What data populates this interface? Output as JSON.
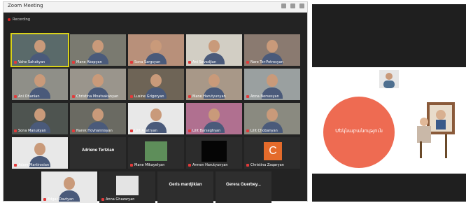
{
  "call": {
    "title": "Zoom Meeting",
    "recording_label": "Recording",
    "tiles": [
      {
        "name": "Vahe Sahakyan",
        "type": "video",
        "bg": "#5a6a6a",
        "active": true
      },
      {
        "name": "Mane Akopyan",
        "type": "video",
        "bg": "#7a7a70"
      },
      {
        "name": "Sona Sargsyan",
        "type": "video",
        "bg": "#b8907a"
      },
      {
        "name": "Ani Sevadjian",
        "type": "video",
        "bg": "#d2cec4"
      },
      {
        "name": "Nare Ter-Petrosyan",
        "type": "video",
        "bg": "#8a7a70"
      },
      {
        "name": "Ani Ohanian",
        "type": "video",
        "bg": "#8f8f88"
      },
      {
        "name": "Christina Mnatsakanyan",
        "type": "video",
        "bg": "#9a958c"
      },
      {
        "name": "Lusine Grigoryan",
        "type": "video",
        "bg": "#6e6456"
      },
      {
        "name": "Mane Harutyunyan",
        "type": "video",
        "bg": "#a89888"
      },
      {
        "name": "Anna Nersesyan",
        "type": "video",
        "bg": "#9aa0a0"
      },
      {
        "name": "Sona Manukyan",
        "type": "video",
        "bg": "#4e5450"
      },
      {
        "name": "Narek Hovhannisyan",
        "type": "video",
        "bg": "#6a6a62"
      },
      {
        "name": "Lilit Asatryan",
        "type": "video",
        "bg": "#e8e8e8"
      },
      {
        "name": "Lilit Barseghyan",
        "type": "video",
        "bg": "#b07090"
      },
      {
        "name": "Lilit Chobanyan",
        "type": "video",
        "bg": "#8a8a80"
      },
      {
        "name": "Adam Martirosian",
        "type": "video",
        "bg": "#e8e8e8"
      },
      {
        "name": "Adriene Tertzian",
        "type": "name"
      },
      {
        "name": "Mane Mikayelyan",
        "type": "image",
        "bg": "#5e8e5a"
      },
      {
        "name": "Armen Harutyunyan",
        "type": "black"
      },
      {
        "name": "Christina Zaqaryan",
        "type": "initial",
        "initial": "C",
        "bg": "#e46b2b"
      },
      {
        "name": "Edgar Davtyan",
        "type": "video",
        "bg": "#e8e8e8"
      },
      {
        "name": "Anna Ghazaryan",
        "type": "image",
        "bg": "#e4e4e4"
      },
      {
        "name": "Geris mardjikian",
        "type": "name"
      },
      {
        "name": "Gerera  Guerbey...",
        "type": "name"
      }
    ]
  },
  "share": {
    "slide_title": "Մեկնաբանություն"
  },
  "colors": {
    "slide_circle": "#ee6b52",
    "mic_muted": "#e23a3a",
    "active_speaker": "#d9d219"
  }
}
